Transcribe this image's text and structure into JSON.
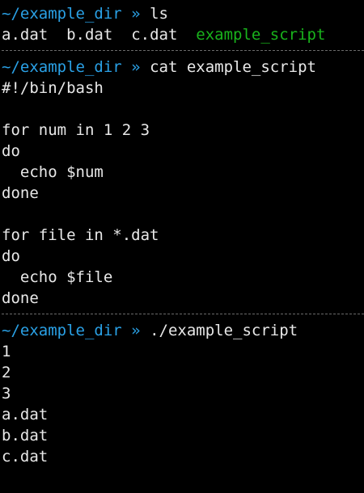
{
  "colors": {
    "background": "#000000",
    "text": "#e8e8e8",
    "prompt": "#2aa1e6",
    "executable": "#19b31c",
    "separator": "#6b6b6b"
  },
  "blocks": [
    {
      "prompt_path": "~/example_dir",
      "prompt_symbol": "»",
      "command": "ls",
      "ls_files": [
        "a.dat",
        "b.dat",
        "c.dat"
      ],
      "ls_executable": "example_script"
    },
    {
      "prompt_path": "~/example_dir",
      "prompt_symbol": "»",
      "command": "cat example_script",
      "output": [
        "#!/bin/bash",
        "",
        "for num in 1 2 3",
        "do",
        "  echo $num",
        "done",
        "",
        "for file in *.dat",
        "do",
        "  echo $file",
        "done"
      ]
    },
    {
      "prompt_path": "~/example_dir",
      "prompt_symbol": "»",
      "command": "./example_script",
      "output": [
        "1",
        "2",
        "3",
        "a.dat",
        "b.dat",
        "c.dat"
      ]
    }
  ]
}
